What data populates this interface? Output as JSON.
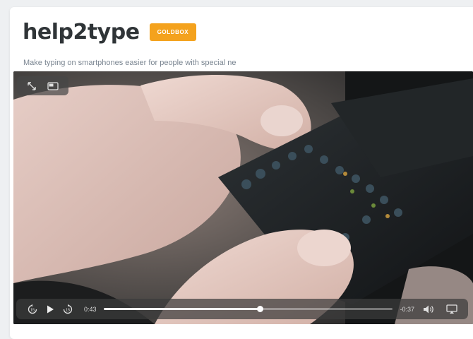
{
  "project": {
    "title": "help2type",
    "badge": "GOLDBOX",
    "description": "Make typing on smartphones easier for people with special ne"
  },
  "video": {
    "current_time": "0:43",
    "remaining_time": "-0:37",
    "progress": 0.54,
    "top_controls": [
      "expand-icon",
      "picture-in-picture-icon"
    ],
    "bottom_controls": [
      "skip-back-15-icon",
      "play-icon",
      "skip-forward-15-icon",
      "volume-icon",
      "airplay-icon"
    ]
  },
  "colors": {
    "badge": "#f4a21d",
    "title": "#2f3437",
    "subtitle": "#7a8591"
  }
}
